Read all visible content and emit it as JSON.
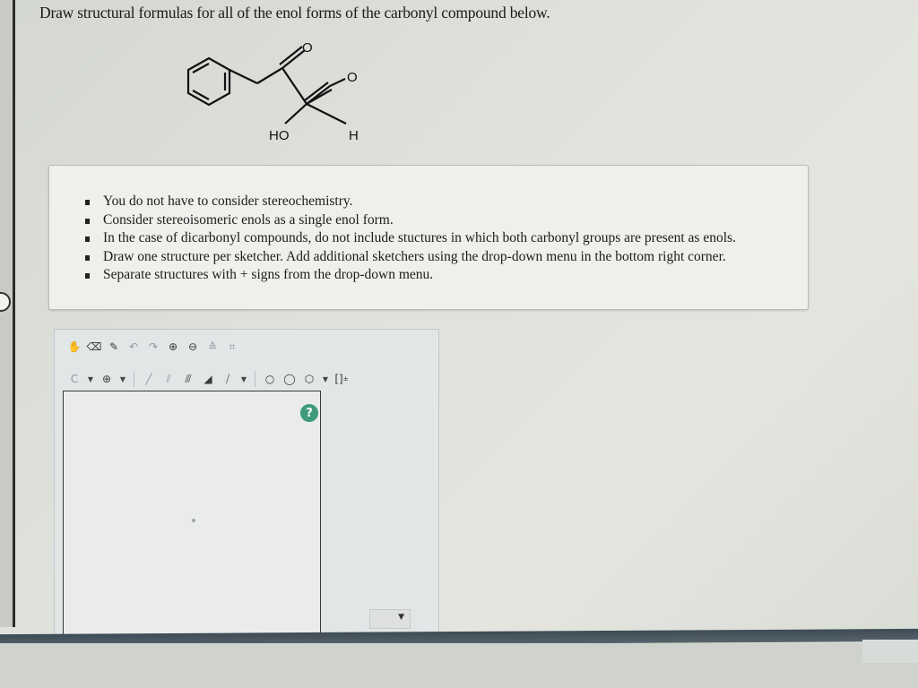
{
  "question": {
    "text": "Draw structural formulas for all of the enol forms of the carbonyl compound below."
  },
  "molecule": {
    "atom_labels": {
      "oxygen_1": "O",
      "oxygen_2": "O",
      "hydroxyl": "HO",
      "aldehyde_h": "H"
    }
  },
  "instructions": {
    "items": [
      "You do not have to consider stereochemistry.",
      "Consider stereoisomeric enols as a single enol form.",
      "In the case of dicarbonyl compounds, do not include stuctures in which both carbonyl groups are present as enols.",
      "Draw one structure per sketcher. Add additional sketchers using the drop-down menu in the bottom right corner.",
      "Separate structures with + signs from the drop-down menu."
    ]
  },
  "sketcher": {
    "toolbar_row1": [
      "hand-icon",
      "eraser-icon",
      "pencil-icon",
      "lasso-icon",
      "redo-icon",
      "zoom-in-icon",
      "zoom-out-icon",
      "template-icon",
      "clean-icon"
    ],
    "toolbar_row2": {
      "element_label": "C",
      "charge_label": "⊕",
      "ring_label": "⬡",
      "bracket_label": "[]",
      "bracket_super": "±"
    },
    "help_label": "?"
  },
  "colors": {
    "accent": "#3e9a7a",
    "bar": "#45525b"
  }
}
